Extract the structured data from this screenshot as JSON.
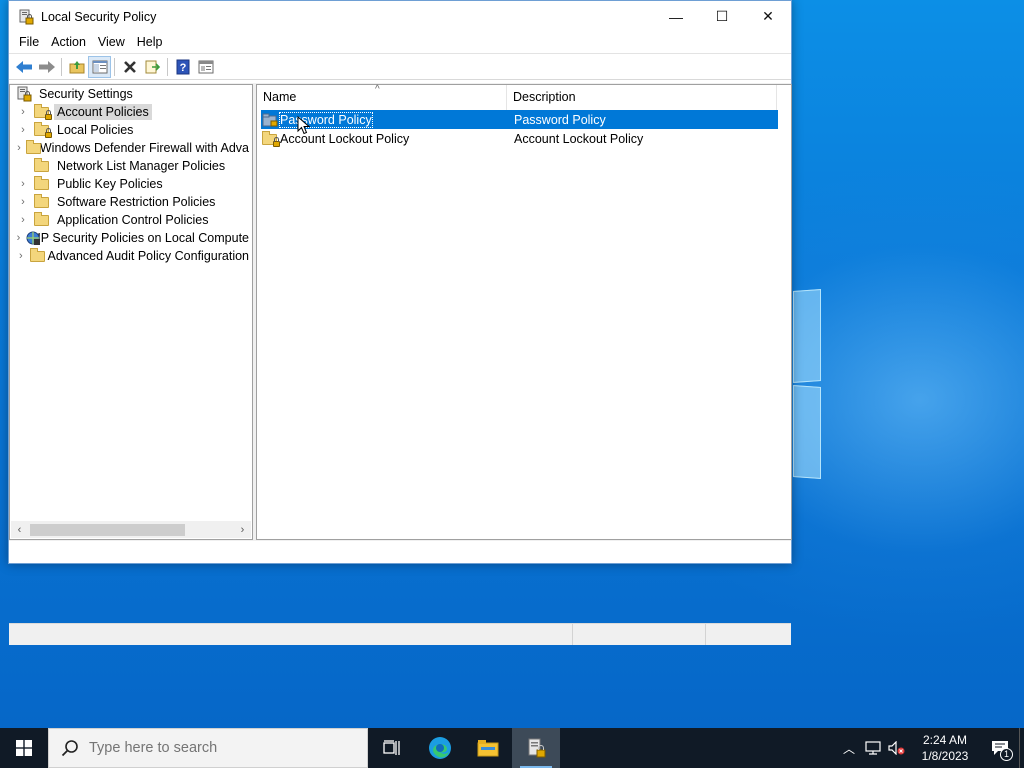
{
  "window": {
    "title": "Local Security Policy",
    "controls": {
      "minimize": "—",
      "maximize": "☐",
      "close": "✕"
    }
  },
  "menu": [
    "File",
    "Action",
    "View",
    "Help"
  ],
  "toolbar": {
    "icons": [
      "back-icon",
      "forward-icon",
      "up-folder-icon",
      "show-hide-tree-icon",
      "delete-icon",
      "export-list-icon",
      "help-icon",
      "properties-icon"
    ]
  },
  "tree": {
    "root": "Security Settings",
    "items": [
      {
        "label": "Account Policies",
        "icon": "folder-lock",
        "expandable": true,
        "selected": true
      },
      {
        "label": "Local Policies",
        "icon": "folder-lock",
        "expandable": true
      },
      {
        "label": "Windows Defender Firewall with Adva",
        "icon": "folder",
        "expandable": true
      },
      {
        "label": "Network List Manager Policies",
        "icon": "folder",
        "expandable": false
      },
      {
        "label": "Public Key Policies",
        "icon": "folder",
        "expandable": true
      },
      {
        "label": "Software Restriction Policies",
        "icon": "folder",
        "expandable": true
      },
      {
        "label": "Application Control Policies",
        "icon": "folder",
        "expandable": true
      },
      {
        "label": "IP Security Policies on Local Compute",
        "icon": "ip-security",
        "expandable": true
      },
      {
        "label": "Advanced Audit Policy Configuration",
        "icon": "folder",
        "expandable": true
      }
    ]
  },
  "list": {
    "columns": [
      "Name",
      "Description"
    ],
    "rows": [
      {
        "name": "Password Policy",
        "description": "Password Policy",
        "selected": true
      },
      {
        "name": "Account Lockout Policy",
        "description": "Account Lockout Policy",
        "selected": false
      }
    ]
  },
  "taskbar": {
    "search_placeholder": "Type here to search",
    "time": "2:24 AM",
    "date": "1/8/2023",
    "notification_count": "1"
  },
  "colors": {
    "selection": "#0078d7",
    "taskbar": "#101a26",
    "desktop": "#0a7ad8"
  }
}
